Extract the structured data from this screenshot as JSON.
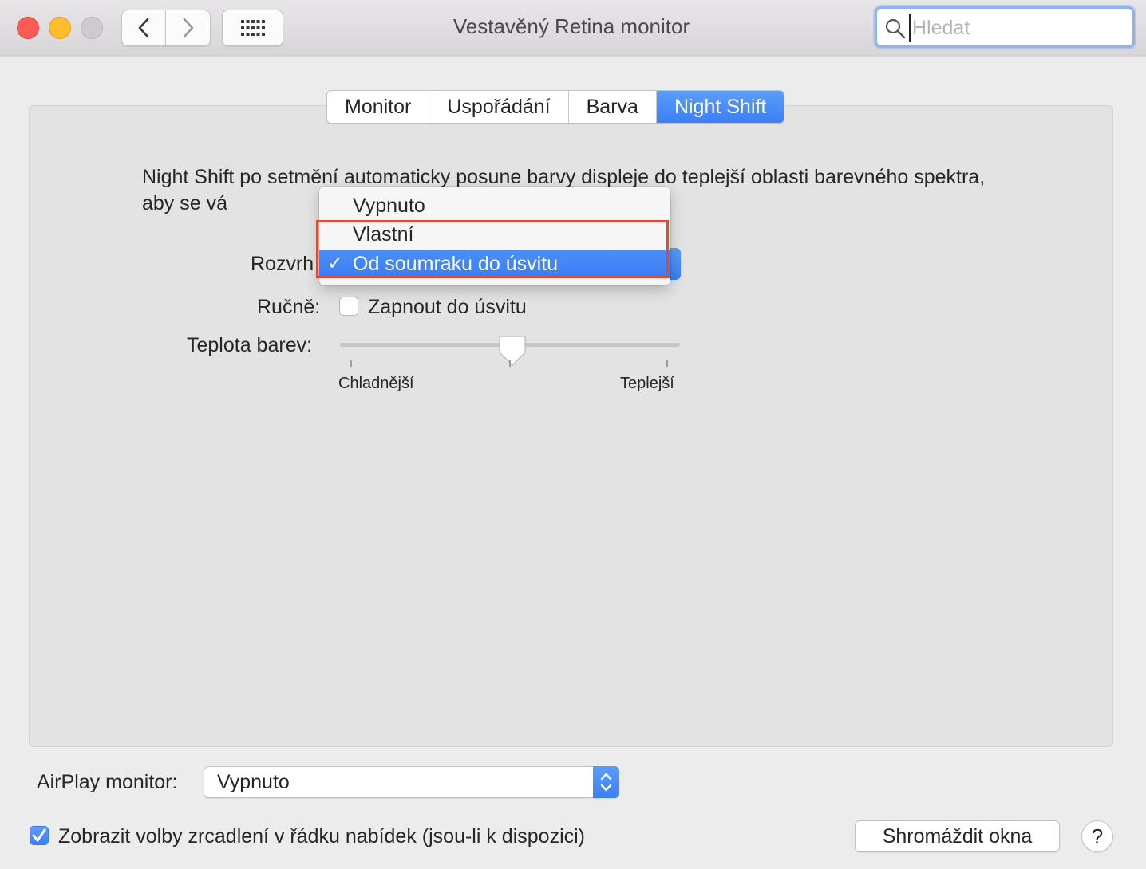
{
  "window": {
    "title": "Vestavěný Retina monitor",
    "search_placeholder": "Hledat"
  },
  "icons": {
    "back": "chevron-left-icon",
    "forward": "chevron-right-icon",
    "grid": "grid-icon",
    "search": "search-icon",
    "check": "checkmark-icon"
  },
  "tabs": [
    {
      "label": "Monitor",
      "active": false
    },
    {
      "label": "Uspořádání",
      "active": false
    },
    {
      "label": "Barva",
      "active": false
    },
    {
      "label": "Night Shift",
      "active": true
    }
  ],
  "night_shift": {
    "description": "Night Shift po setmění automaticky posune barvy displeje do teplejší oblasti barevného spektra, aby se vá",
    "schedule_label": "Rozvrh",
    "manual_label": "Ručně:",
    "manual_checkbox_label": "Zapnout do úsvitu",
    "manual_checked": false,
    "temperature_label": "Teplota barev:",
    "temperature_min_label": "Chladnější",
    "temperature_max_label": "Teplejší",
    "temperature_value": 0.5
  },
  "schedule_menu": {
    "items": [
      {
        "label": "Vypnuto",
        "selected": false
      },
      {
        "label": "Vlastní",
        "selected": false
      },
      {
        "label": "Od soumraku do úsvitu",
        "selected": true
      }
    ],
    "check_glyph": "✓"
  },
  "airplay": {
    "label": "AirPlay monitor:",
    "value": "Vypnuto"
  },
  "mirroring": {
    "label": "Zobrazit volby zrcadlení v řádku nabídek (jsou-li k dispozici)",
    "checked": true
  },
  "buttons": {
    "gather_windows": "Shromáždit okna",
    "help": "?"
  },
  "colors": {
    "accent": "#3b7ff5",
    "highlight_annotation": "#e2492f"
  }
}
